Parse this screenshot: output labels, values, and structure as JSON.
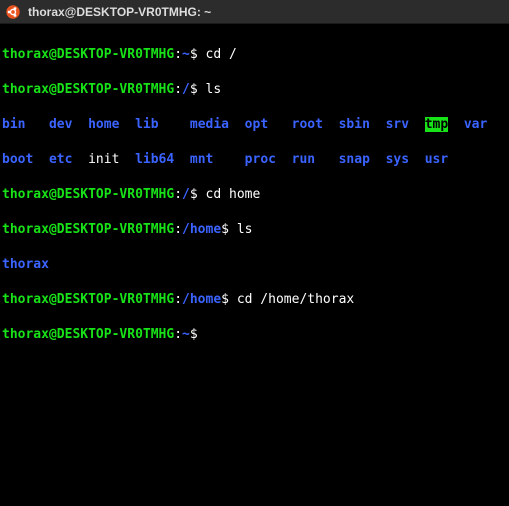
{
  "window": {
    "title": "thorax@DESKTOP-VR0TMHG: ~"
  },
  "p1": {
    "user": "thorax",
    "at": "@",
    "host": "DESKTOP-VR0TMHG",
    "colon": ":",
    "path": "~",
    "symbol": "$ "
  },
  "p2": {
    "user": "thorax",
    "at": "@",
    "host": "DESKTOP-VR0TMHG",
    "colon": ":",
    "path": "/",
    "symbol": "$ "
  },
  "p3": {
    "user": "thorax",
    "at": "@",
    "host": "DESKTOP-VR0TMHG",
    "colon": ":",
    "path": "/",
    "symbol": "$ "
  },
  "p4": {
    "user": "thorax",
    "at": "@",
    "host": "DESKTOP-VR0TMHG",
    "colon": ":",
    "path": "/home",
    "symbol": "$ "
  },
  "p5": {
    "user": "thorax",
    "at": "@",
    "host": "DESKTOP-VR0TMHG",
    "colon": ":",
    "path": "/home",
    "symbol": "$ "
  },
  "p6": {
    "user": "thorax",
    "at": "@",
    "host": "DESKTOP-VR0TMHG",
    "colon": ":",
    "path": "~",
    "symbol": "$ "
  },
  "cmds": {
    "cd_root": "cd /",
    "ls1": "ls",
    "cd_home": "cd home",
    "ls2": "ls",
    "cd_thorax": "cd /home/thorax",
    "empty": ""
  },
  "root_ls": {
    "r1": {
      "bin": "bin",
      "dev": "dev",
      "home": "home",
      "lib": "lib",
      "media": "media",
      "opt": "opt",
      "root": "root",
      "sbin": "sbin",
      "srv": "srv",
      "tmp": "tmp",
      "var": "var"
    },
    "r2": {
      "boot": "boot",
      "etc": "etc",
      "init": "init",
      "lib64": "lib64",
      "mnt": "mnt",
      "proc": "proc",
      "run": "run",
      "snap": "snap",
      "sys": "sys",
      "usr": "usr"
    }
  },
  "home_ls": {
    "thorax": "thorax"
  }
}
